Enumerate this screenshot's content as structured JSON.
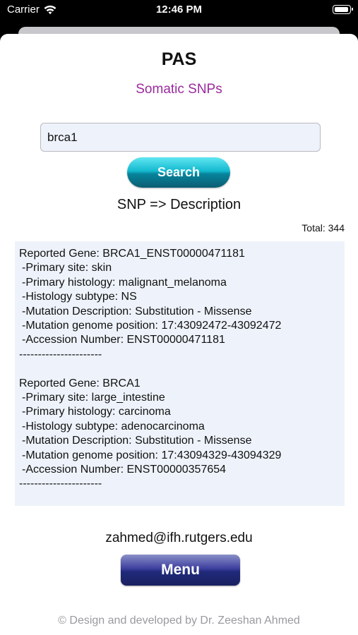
{
  "status_bar": {
    "carrier": "Carrier",
    "time": "12:46 PM"
  },
  "header": {
    "title": "PAS",
    "subtitle": "Somatic SNPs"
  },
  "search": {
    "value": "brca1",
    "button_label": "Search"
  },
  "section_heading": "SNP => Description",
  "total": "Total: 344",
  "records": [
    {
      "gene": "Reported Gene: BRCA1_ENST00000471181",
      "lines": [
        "-Primary site: skin",
        "-Primary histology: malignant_melanoma",
        "-Histology subtype: NS",
        "-Mutation Description: Substitution - Missense",
        "-Mutation genome position: 17:43092472-43092472",
        "-Accession Number: ENST00000471181"
      ],
      "separator": "----------------------"
    },
    {
      "gene": "Reported Gene: BRCA1",
      "lines": [
        "-Primary site: large_intestine",
        "-Primary histology: carcinoma",
        "-Histology subtype: adenocarcinoma",
        "-Mutation Description: Substitution - Missense",
        "-Mutation genome position: 17:43094329-43094329",
        "-Accession Number: ENST00000357654"
      ],
      "separator": "----------------------"
    }
  ],
  "footer": {
    "email": "zahmed@ifh.rutgers.edu",
    "menu_label": "Menu",
    "credit": "© Design and developed by Dr. Zeeshan Ahmed"
  },
  "colors": {
    "subtitle": "#9a2a9e",
    "search_button": "#14b9cf",
    "menu_button": "#202a7a",
    "results_background": "#eef3fb"
  },
  "icons": [
    "wifi-icon",
    "battery-icon"
  ]
}
